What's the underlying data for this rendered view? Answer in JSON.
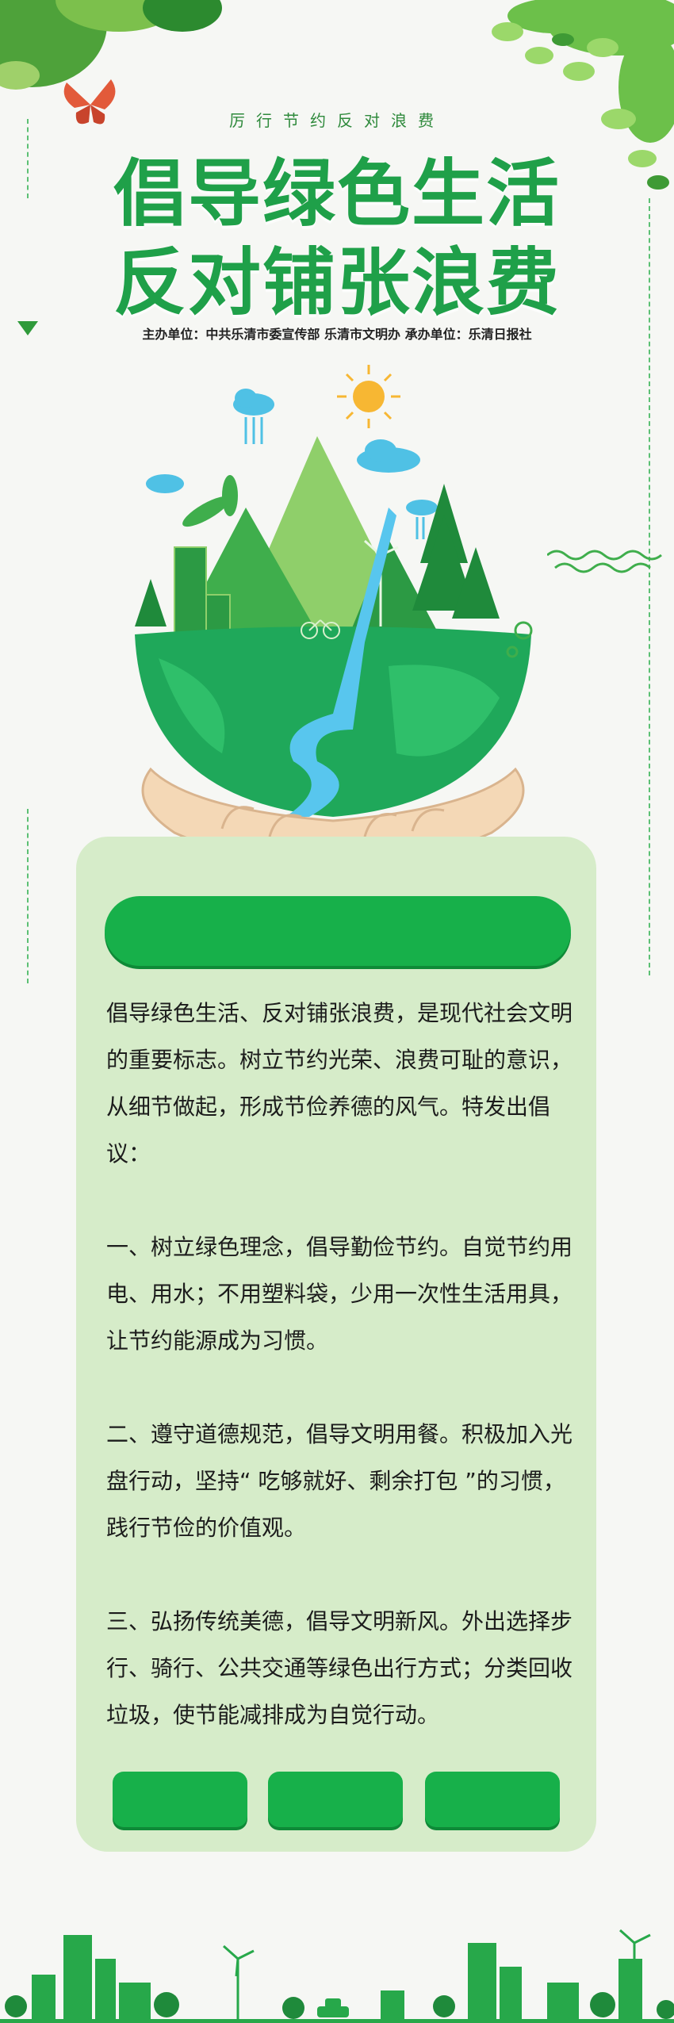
{
  "header": {
    "subtitle": "厉行节约反对浪费",
    "title_line1": "倡导绿色生活",
    "title_line2": "反对铺张浪费",
    "sponsors": "主办单位：中共乐清市委宣传部  乐清市文明办   承办单位：乐清日报社"
  },
  "content": {
    "paragraphs": [
      "倡导绿色生活、反对铺张浪费，是现代社会文明的重要标志。树立节约光荣、浪费可耻的意识，从细节做起，形成节俭养德的风气。特发出倡议：",
      "一、树立绿色理念，倡导勤俭节约。自觉节约用电、用水；不用塑料袋，少用一次性生活用具，让节约能源成为习惯。",
      "二、遵守道德规范，倡导文明用餐。积极加入光盘行动，坚持“ 吃够就好、剩余打包 ”的习惯，践行节俭的价值观。",
      "三、弘扬传统美德，倡导文明新风。外出选择步行、骑行、公共交通等绿色出行方式；分类回收垃圾，使节能减排成为自觉行动。"
    ]
  },
  "colors": {
    "primary_green": "#17b04a",
    "title_green": "#1fa049",
    "card_bg": "#d6ecc9",
    "page_bg": "#f6f7f4"
  },
  "icons": [
    "butterfly-icon",
    "sun-icon",
    "cloud-icon",
    "rain-icon",
    "wind-turbine-icon",
    "tree-icon",
    "building-icon",
    "bicycle-icon",
    "car-icon"
  ]
}
